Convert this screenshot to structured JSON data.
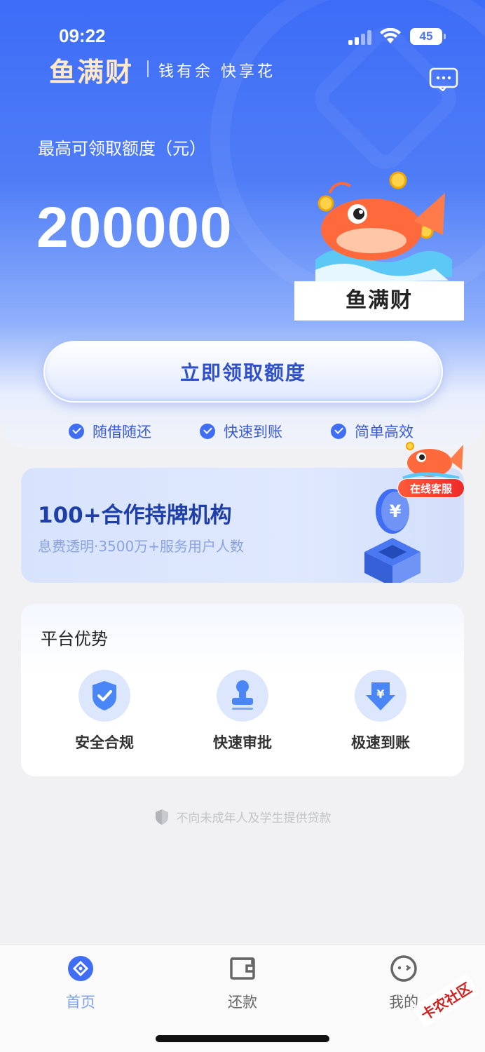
{
  "status_bar": {
    "time": "09:22",
    "battery": "45"
  },
  "brand": {
    "logo_text": "鱼满财",
    "slogan": "钱有余 快享花"
  },
  "hero": {
    "quota_label": "最高可领取额度（元）",
    "quota_amount": "200000",
    "mascot_name": "鱼满财",
    "cta_label": "立即领取额度"
  },
  "features": [
    "随借随还",
    "快速到账",
    "简单高效"
  ],
  "partner": {
    "title": "100+合作持牌机构",
    "subtitle": "息费透明·3500万+服务用户人数"
  },
  "service_badge": "在线客服",
  "advantages": {
    "title": "平台优势",
    "items": [
      {
        "label": "安全合规",
        "icon": "shield-check-icon"
      },
      {
        "label": "快速审批",
        "icon": "stamp-icon"
      },
      {
        "label": "极速到账",
        "icon": "download-yuan-icon"
      }
    ]
  },
  "disclaimer": "不向未成年人及学生提供贷款",
  "tabbar": {
    "items": [
      {
        "label": "首页",
        "icon": "home-icon",
        "active": true
      },
      {
        "label": "还款",
        "icon": "wallet-icon",
        "active": false
      },
      {
        "label": "我的",
        "icon": "profile-icon",
        "active": false
      }
    ]
  },
  "colors": {
    "primary": "#3f6ef4",
    "cta_text": "#3050c8",
    "badge": "#f02a2a",
    "tab_inactive": "#666666"
  },
  "watermark": "卡农社区"
}
